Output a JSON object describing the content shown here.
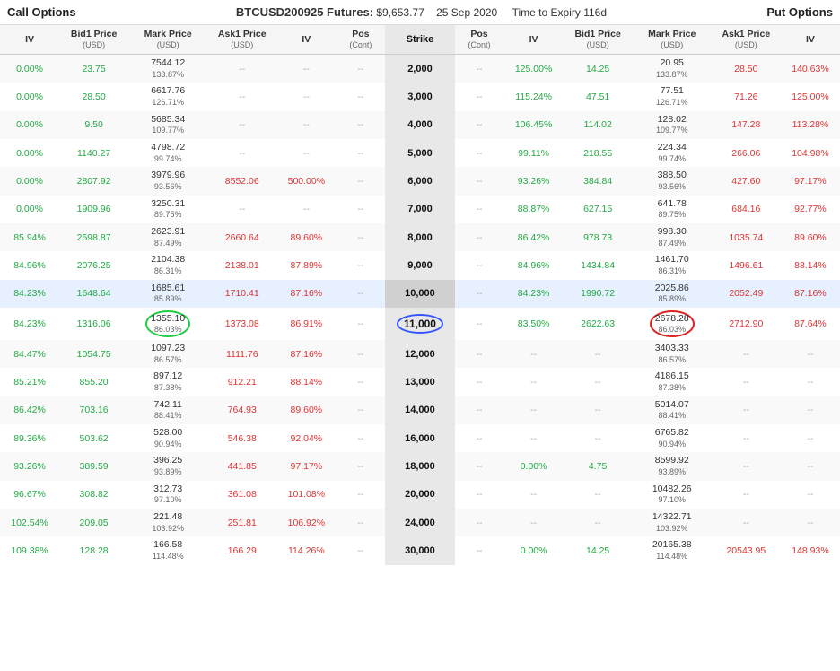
{
  "header": {
    "call_options": "Call Options",
    "put_options": "Put Options",
    "futures": "BTCUSD200925 Futures:",
    "price": "$9,653.77",
    "date": "25 Sep 2020",
    "expiry": "Time to Expiry 116d"
  },
  "columns": {
    "call": [
      "IV",
      "Bid1 Price\n(USD)",
      "Mark Price\n(USD)",
      "Ask1 Price\n(USD)",
      "IV",
      "Pos\n(Cont)"
    ],
    "strike": "Strike",
    "put": [
      "Pos\n(Cont)",
      "IV",
      "Bid1 Price\n(USD)",
      "Mark Price\n(USD)",
      "Ask1 Price\n(USD)",
      "IV"
    ]
  },
  "rows": [
    {
      "call_iv": "0.00%",
      "call_bid": "23.75",
      "call_mark": "7544.12",
      "call_mark_pct": "133.87%",
      "call_ask": "--",
      "call_iv2": "--",
      "call_pos": "--",
      "strike": "2,000",
      "put_pos": "--",
      "put_iv": "125.00%",
      "put_bid": "14.25",
      "put_mark": "20.95",
      "put_mark_pct": "133.87%",
      "put_ask": "28.50",
      "put_iv2": "140.63%"
    },
    {
      "call_iv": "0.00%",
      "call_bid": "28.50",
      "call_mark": "6617.76",
      "call_mark_pct": "126.71%",
      "call_ask": "--",
      "call_iv2": "--",
      "call_pos": "--",
      "strike": "3,000",
      "put_pos": "--",
      "put_iv": "115.24%",
      "put_bid": "47.51",
      "put_mark": "77.51",
      "put_mark_pct": "126.71%",
      "put_ask": "71.26",
      "put_iv2": "125.00%"
    },
    {
      "call_iv": "0.00%",
      "call_bid": "9.50",
      "call_mark": "5685.34",
      "call_mark_pct": "109.77%",
      "call_ask": "--",
      "call_iv2": "--",
      "call_pos": "--",
      "strike": "4,000",
      "put_pos": "--",
      "put_iv": "106.45%",
      "put_bid": "114.02",
      "put_mark": "128.02",
      "put_mark_pct": "109.77%",
      "put_ask": "147.28",
      "put_iv2": "113.28%"
    },
    {
      "call_iv": "0.00%",
      "call_bid": "1140.27",
      "call_mark": "4798.72",
      "call_mark_pct": "99.74%",
      "call_ask": "--",
      "call_iv2": "--",
      "call_pos": "--",
      "strike": "5,000",
      "put_pos": "--",
      "put_iv": "99.11%",
      "put_bid": "218.55",
      "put_mark": "224.34",
      "put_mark_pct": "99.74%",
      "put_ask": "266.06",
      "put_iv2": "104.98%"
    },
    {
      "call_iv": "0.00%",
      "call_bid": "2807.92",
      "call_mark": "3979.96",
      "call_mark_pct": "93.56%",
      "call_ask": "8552.06",
      "call_iv2": "500.00%",
      "call_pos": "--",
      "strike": "6,000",
      "put_pos": "--",
      "put_iv": "93.26%",
      "put_bid": "384.84",
      "put_mark": "388.50",
      "put_mark_pct": "93.56%",
      "put_ask": "427.60",
      "put_iv2": "97.17%"
    },
    {
      "call_iv": "0.00%",
      "call_bid": "1909.96",
      "call_mark": "3250.31",
      "call_mark_pct": "89.75%",
      "call_ask": "--",
      "call_iv2": "--",
      "call_pos": "--",
      "strike": "7,000",
      "put_pos": "--",
      "put_iv": "88.87%",
      "put_bid": "627.15",
      "put_mark": "641.78",
      "put_mark_pct": "89.75%",
      "put_ask": "684.16",
      "put_iv2": "92.77%"
    },
    {
      "call_iv": "85.94%",
      "call_bid": "2598.87",
      "call_mark": "2623.91",
      "call_mark_pct": "87.49%",
      "call_ask": "2660.64",
      "call_iv2": "89.60%",
      "call_pos": "--",
      "strike": "8,000",
      "put_pos": "--",
      "put_iv": "86.42%",
      "put_bid": "978.73",
      "put_mark": "998.30",
      "put_mark_pct": "87.49%",
      "put_ask": "1035.74",
      "put_iv2": "89.60%"
    },
    {
      "call_iv": "84.96%",
      "call_bid": "2076.25",
      "call_mark": "2104.38",
      "call_mark_pct": "86.31%",
      "call_ask": "2138.01",
      "call_iv2": "87.89%",
      "call_pos": "--",
      "strike": "9,000",
      "put_pos": "--",
      "put_iv": "84.96%",
      "put_bid": "1434.84",
      "put_mark": "1461.70",
      "put_mark_pct": "86.31%",
      "put_ask": "1496.61",
      "put_iv2": "88.14%"
    },
    {
      "call_iv": "84.23%",
      "call_bid": "1648.64",
      "call_mark": "1685.61",
      "call_mark_pct": "85.89%",
      "call_ask": "1710.41",
      "call_iv2": "87.16%",
      "call_pos": "--",
      "strike": "10,000",
      "put_pos": "--",
      "put_iv": "84.23%",
      "put_bid": "1990.72",
      "put_mark": "2025.86",
      "put_mark_pct": "85.89%",
      "put_ask": "2052.49",
      "put_iv2": "87.16%",
      "highlight": true
    },
    {
      "call_iv": "84.23%",
      "call_bid": "1316.06",
      "call_mark": "1355.10",
      "call_mark_pct": "86.03%",
      "call_ask": "1373.08",
      "call_iv2": "86.91%",
      "call_pos": "--",
      "strike": "11,000",
      "put_pos": "--",
      "put_iv": "83.50%",
      "put_bid": "2622.63",
      "put_mark": "2678.28",
      "put_mark_pct": "86.03%",
      "put_ask": "2712.90",
      "put_iv2": "87.64%",
      "circle_strike": true,
      "circle_call_mark": true,
      "circle_put_mark": true
    },
    {
      "call_iv": "84.47%",
      "call_bid": "1054.75",
      "call_mark": "1097.23",
      "call_mark_pct": "86.57%",
      "call_ask": "1111.76",
      "call_iv2": "87.16%",
      "call_pos": "--",
      "strike": "12,000",
      "put_pos": "--",
      "put_iv": "--",
      "put_bid": "--",
      "put_mark": "3403.33",
      "put_mark_pct": "86.57%",
      "put_ask": "--",
      "put_iv2": "--"
    },
    {
      "call_iv": "85.21%",
      "call_bid": "855.20",
      "call_mark": "897.12",
      "call_mark_pct": "87.38%",
      "call_ask": "912.21",
      "call_iv2": "88.14%",
      "call_pos": "--",
      "strike": "13,000",
      "put_pos": "--",
      "put_iv": "--",
      "put_bid": "--",
      "put_mark": "4186.15",
      "put_mark_pct": "87.38%",
      "put_ask": "--",
      "put_iv2": "--"
    },
    {
      "call_iv": "86.42%",
      "call_bid": "703.16",
      "call_mark": "742.11",
      "call_mark_pct": "88.41%",
      "call_ask": "764.93",
      "call_iv2": "89.60%",
      "call_pos": "--",
      "strike": "14,000",
      "put_pos": "--",
      "put_iv": "--",
      "put_bid": "--",
      "put_mark": "5014.07",
      "put_mark_pct": "88.41%",
      "put_ask": "--",
      "put_iv2": "--"
    },
    {
      "call_iv": "89.36%",
      "call_bid": "503.62",
      "call_mark": "528.00",
      "call_mark_pct": "90.94%",
      "call_ask": "546.38",
      "call_iv2": "92.04%",
      "call_pos": "--",
      "strike": "16,000",
      "put_pos": "--",
      "put_iv": "--",
      "put_bid": "--",
      "put_mark": "6765.82",
      "put_mark_pct": "90.94%",
      "put_ask": "--",
      "put_iv2": "--"
    },
    {
      "call_iv": "93.26%",
      "call_bid": "389.59",
      "call_mark": "396.25",
      "call_mark_pct": "93.89%",
      "call_ask": "441.85",
      "call_iv2": "97.17%",
      "call_pos": "--",
      "strike": "18,000",
      "put_pos": "--",
      "put_iv": "0.00%",
      "put_bid": "4.75",
      "put_mark": "8599.92",
      "put_mark_pct": "93.89%",
      "put_ask": "--",
      "put_iv2": "--"
    },
    {
      "call_iv": "96.67%",
      "call_bid": "308.82",
      "call_mark": "312.73",
      "call_mark_pct": "97.10%",
      "call_ask": "361.08",
      "call_iv2": "101.08%",
      "call_pos": "--",
      "strike": "20,000",
      "put_pos": "--",
      "put_iv": "--",
      "put_bid": "--",
      "put_mark": "10482.26",
      "put_mark_pct": "97.10%",
      "put_ask": "--",
      "put_iv2": "--"
    },
    {
      "call_iv": "102.54%",
      "call_bid": "209.05",
      "call_mark": "221.48",
      "call_mark_pct": "103.92%",
      "call_ask": "251.81",
      "call_iv2": "106.92%",
      "call_pos": "--",
      "strike": "24,000",
      "put_pos": "--",
      "put_iv": "--",
      "put_bid": "--",
      "put_mark": "14322.71",
      "put_mark_pct": "103.92%",
      "put_ask": "--",
      "put_iv2": "--"
    },
    {
      "call_iv": "109.38%",
      "call_bid": "128.28",
      "call_mark": "166.58",
      "call_mark_pct": "114.48%",
      "call_ask": "166.29",
      "call_iv2": "114.26%",
      "call_pos": "--",
      "strike": "30,000",
      "put_pos": "--",
      "put_iv": "0.00%",
      "put_bid": "14.25",
      "put_mark": "20165.38",
      "put_mark_pct": "114.48%",
      "put_ask": "20543.95",
      "put_iv2": "148.93%"
    }
  ]
}
